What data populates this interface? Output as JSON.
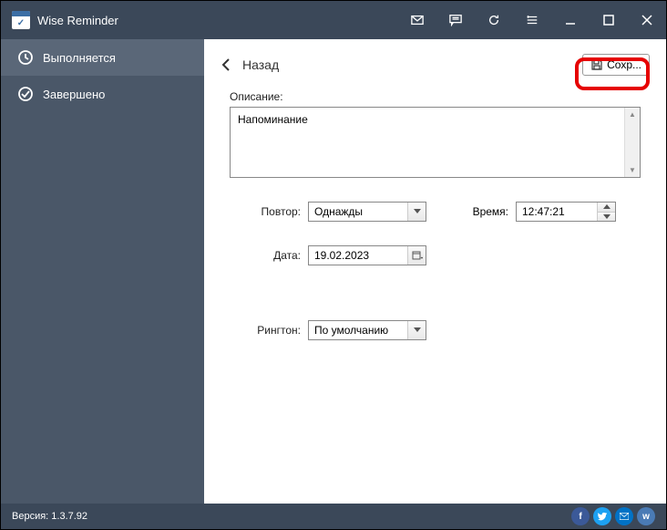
{
  "titlebar": {
    "app_name": "Wise Reminder"
  },
  "sidebar": {
    "items": [
      {
        "label": "Выполняется"
      },
      {
        "label": "Завершено"
      }
    ]
  },
  "header": {
    "back_label": "Назад",
    "save_label": "Сохр..."
  },
  "form": {
    "description_label": "Описание:",
    "description_value": "Напоминание",
    "repeat_label": "Повтор:",
    "repeat_value": "Однажды",
    "time_label": "Время:",
    "time_value": "12:47:21",
    "date_label": "Дата:",
    "date_value": "19.02.2023",
    "ringtone_label": "Рингтон:",
    "ringtone_value": "По умолчанию"
  },
  "footer": {
    "version_label": "Версия: 1.3.7.92"
  }
}
